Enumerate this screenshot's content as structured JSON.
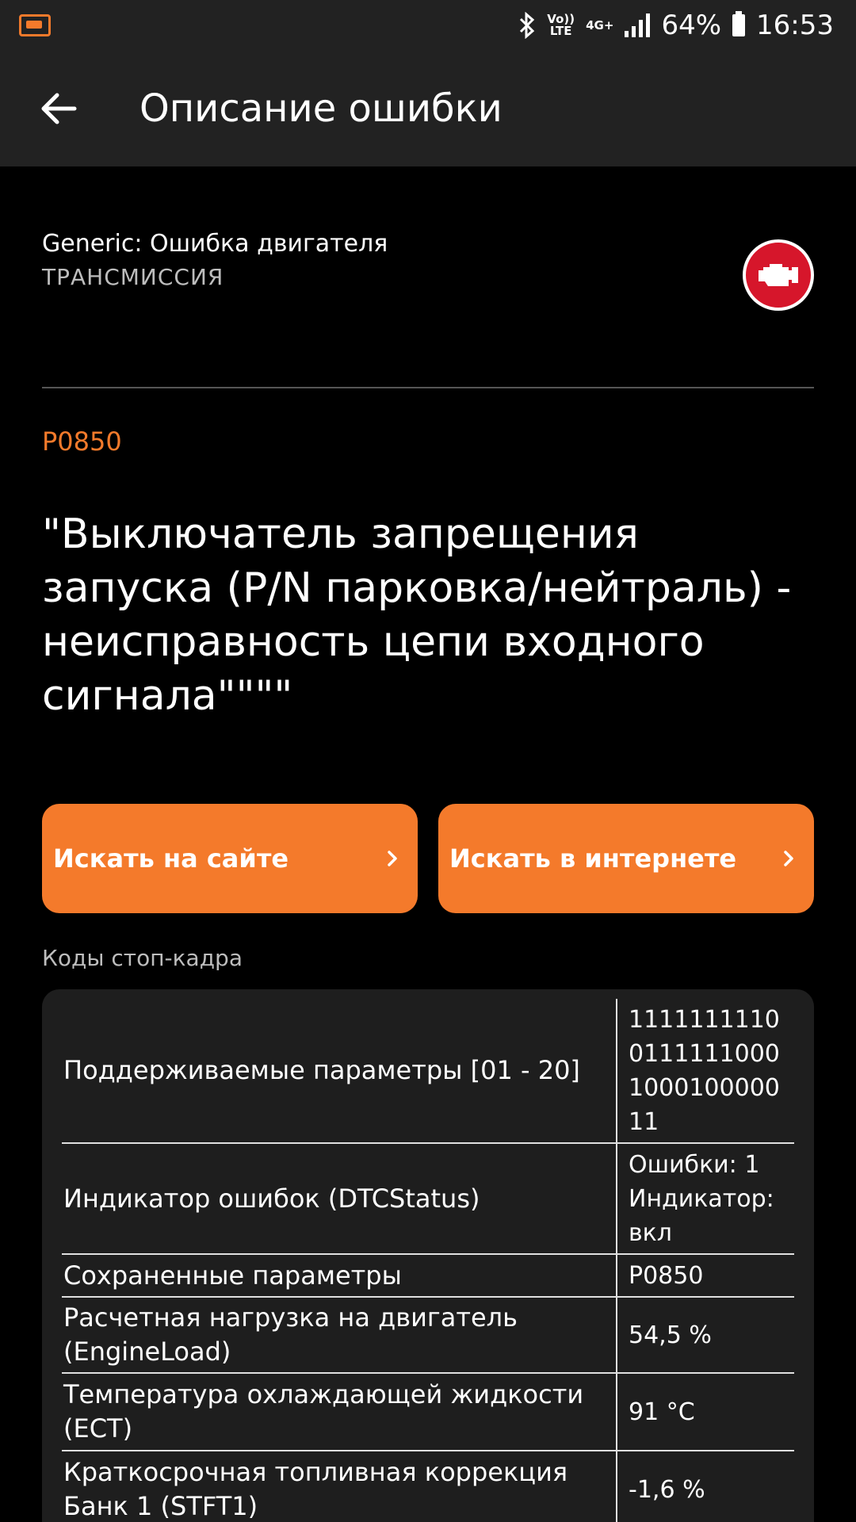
{
  "status_bar": {
    "network_top": "Vo))",
    "network_bottom": "LTE",
    "data_type": "4G+",
    "battery": "64%",
    "time": "16:53",
    "icons": [
      "app-notification-icon",
      "bluetooth-icon",
      "signal-icon",
      "battery-icon"
    ]
  },
  "app_bar": {
    "title": "Описание ошибки"
  },
  "error": {
    "make_line": "Generic: Ошибка двигателя",
    "category": "ТРАНСМИССИЯ",
    "code": "P0850",
    "description": "\"Выключатель запрещения запуска (P/N парковка/нейтраль) - неисправность цепи входного сигнала\"\"\"\"",
    "icon_color": "#d6162b"
  },
  "actions": {
    "search_site": "Искать на сайте",
    "search_web": "Искать в интернете"
  },
  "freeze_frame": {
    "title": "Коды стоп-кадра",
    "rows": [
      {
        "name": "Поддерживаемые параметры [01 - 20]",
        "value": "11111111100111111000100010000011"
      },
      {
        "name": "Индикатор ошибок (DTCStatus)",
        "value": "Ошибки: 1 Индикатор: вкл"
      },
      {
        "name": "Сохраненные параметры",
        "value": "P0850"
      },
      {
        "name": "Расчетная нагрузка на двигатель (EngineLoad)",
        "value": "54,5 %"
      },
      {
        "name": "Температура охлаждающей жидкости (ECT)",
        "value": "91 °C"
      },
      {
        "name": "Краткосрочная топливная коррекция Банк 1 (STFT1)",
        "value": "-1,6 %"
      }
    ]
  },
  "colors": {
    "accent": "#f47a2b",
    "background": "#000000",
    "bar": "#222222",
    "card": "#1e1e1e"
  }
}
